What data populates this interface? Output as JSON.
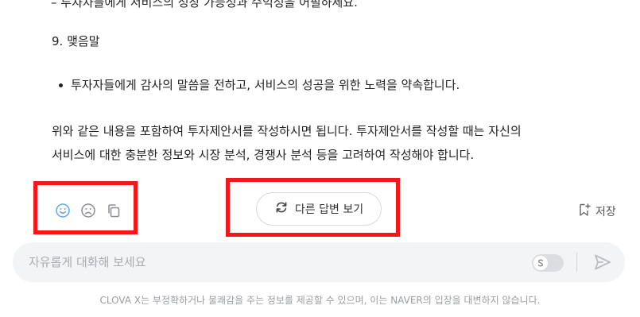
{
  "answer": {
    "cutoff_text": "– 투자자들에게 서비스의 성장 가능성과 수익성을 어필하세요.",
    "section_heading": "9.  맺음말",
    "bullet": "투자자들에게 감사의 말씀을 전하고, 서비스의 성공을 위한 노력을 약속합니다.",
    "paragraph_line1": "위와 같은 내용을 포함하여 투자제안서를 작성하시면 됩니다. 투자제안서를 작성할 때는 자신의",
    "paragraph_line2": "서비스에 대한 충분한 정보와 시장 분석, 경쟁사 분석 등을 고려하여 작성해야 합니다."
  },
  "actions": {
    "like_icon": "smile-icon",
    "dislike_icon": "frown-icon",
    "copy_icon": "copy-icon",
    "regenerate_label": "다른 답변 보기",
    "regenerate_icon": "refresh-icon",
    "save_label": "저장",
    "save_icon": "bookmark-add-icon"
  },
  "chat": {
    "placeholder": "자유롭게 대화해 보세요",
    "toggle_icon": "skill-icon",
    "send_icon": "send-icon"
  },
  "footer": {
    "disclaimer": "CLOVA X는 부정확하거나 불쾌감을 주는 정보를 제공할 수 있으며, 이는 NAVER의 입장을 대변하지 않습니다."
  },
  "colors": {
    "accent": "#5aa7f5",
    "highlight_box": "#f1171b",
    "muted_text": "#9a9da3"
  }
}
